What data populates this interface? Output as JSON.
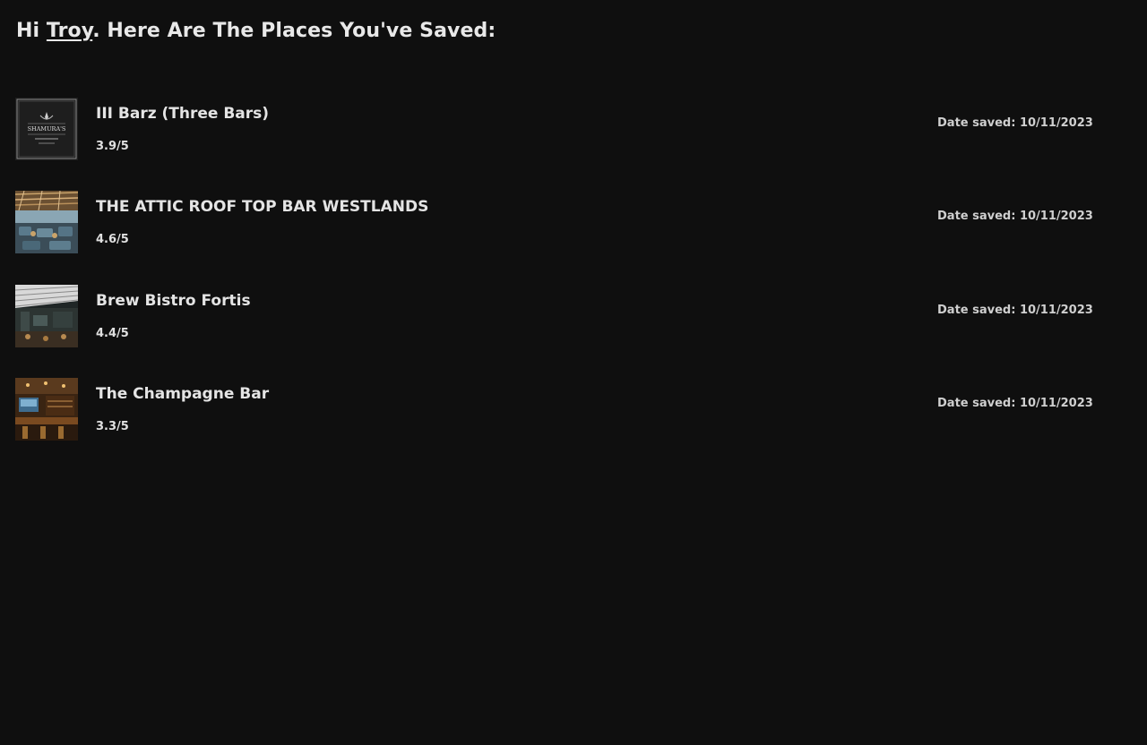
{
  "header": {
    "greeting_prefix": "Hi",
    "user_name": "Troy",
    "greeting_suffix": ". Here Are The Places You've Saved:"
  },
  "saved_places": [
    {
      "name": "III Barz (Three Bars)",
      "rating": "3.9/5",
      "date_saved": "Date saved: 10/11/2023",
      "thumbnail_text": "SHAMURA'S"
    },
    {
      "name": "THE ATTIC ROOF TOP BAR WESTLANDS",
      "rating": "4.6/5",
      "date_saved": "Date saved: 10/11/2023"
    },
    {
      "name": "Brew Bistro Fortis",
      "rating": "4.4/5",
      "date_saved": "Date saved: 10/11/2023"
    },
    {
      "name": "The Champagne Bar",
      "rating": "3.3/5",
      "date_saved": "Date saved: 10/11/2023"
    }
  ],
  "colors": {
    "background": "#0f0f0f",
    "text": "#e6e6e6",
    "date_text": "#cfcfcf"
  }
}
